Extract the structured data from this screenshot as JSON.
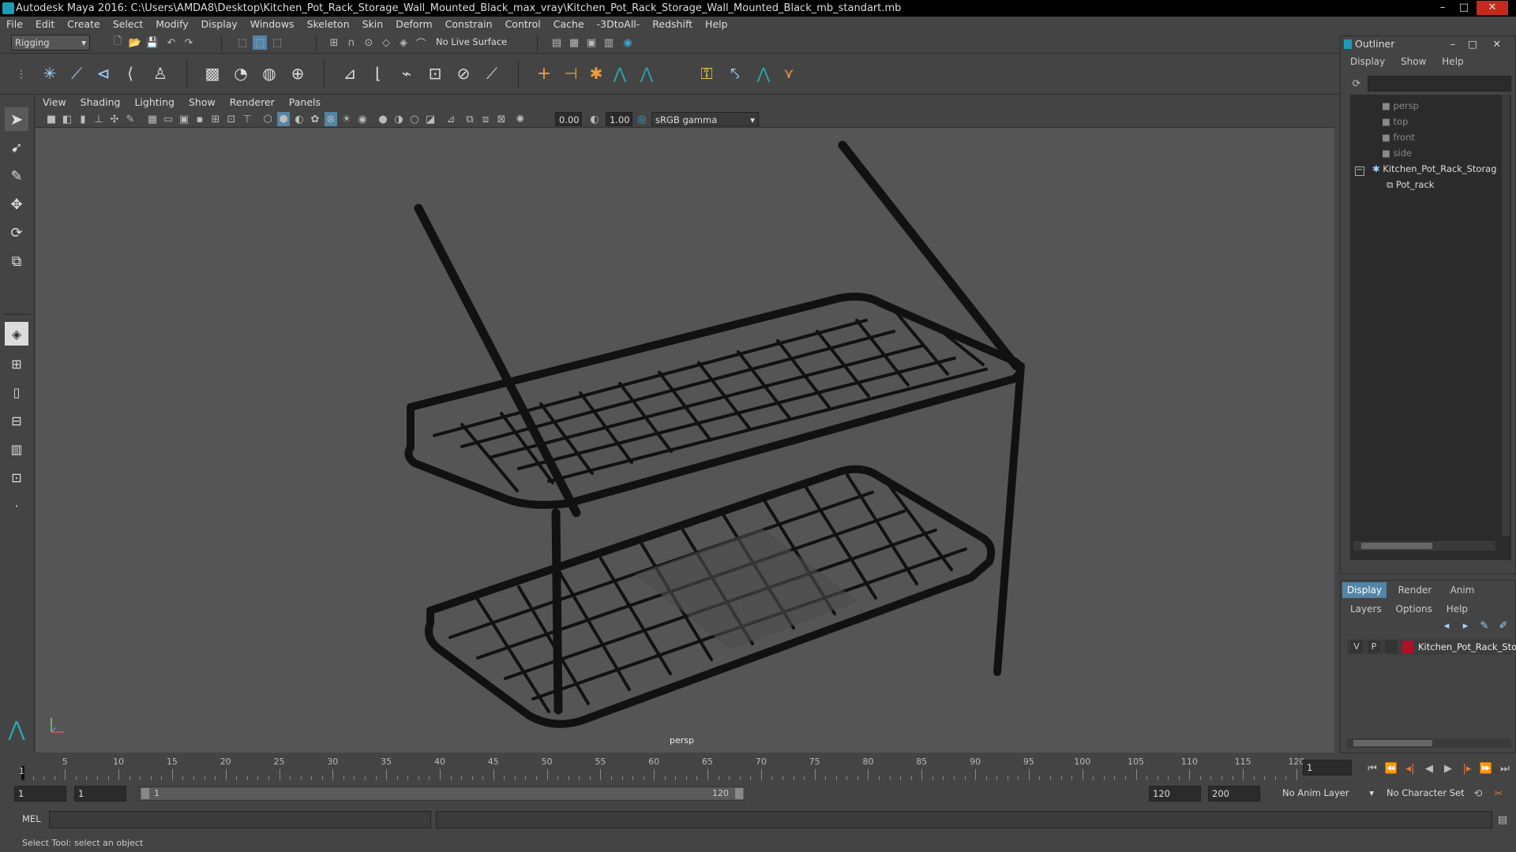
{
  "window": {
    "title": "Autodesk Maya 2016: C:\\Users\\AMDA8\\Desktop\\Kitchen_Pot_Rack_Storage_Wall_Mounted_Black_max_vray\\Kitchen_Pot_Rack_Storage_Wall_Mounted_Black_mb_standart.mb",
    "minimize": "–",
    "maximize": "□",
    "close": "✕"
  },
  "menubar": [
    "File",
    "Edit",
    "Create",
    "Select",
    "Modify",
    "Display",
    "Windows",
    "Skeleton",
    "Skin",
    "Deform",
    "Constrain",
    "Control",
    "Cache",
    "-3DtoAll-",
    "Redshift",
    "Help"
  ],
  "statusline": {
    "menuset": "Rigging",
    "live_surface": "No Live Surface"
  },
  "viewport": {
    "menu": [
      "View",
      "Shading",
      "Lighting",
      "Show",
      "Renderer",
      "Panels"
    ],
    "exposure": "0.00",
    "gamma": "1.00",
    "colorspace": "sRGB gamma",
    "camera_label": "persp"
  },
  "outliner": {
    "title": "Outliner",
    "menu": [
      "Display",
      "Show",
      "Help"
    ],
    "items": [
      {
        "label": "persp",
        "icon": "camera-icon",
        "dim": true
      },
      {
        "label": "top",
        "icon": "camera-icon",
        "dim": true
      },
      {
        "label": "front",
        "icon": "camera-icon",
        "dim": true
      },
      {
        "label": "side",
        "icon": "camera-icon",
        "dim": true
      },
      {
        "label": "Kitchen_Pot_Rack_Storag",
        "icon": "group-icon",
        "dim": false,
        "expand": "−"
      },
      {
        "label": "Pot_rack",
        "icon": "mesh-icon",
        "dim": false
      }
    ]
  },
  "layers": {
    "tabs": [
      "Display",
      "Render",
      "Anim"
    ],
    "menu": [
      "Layers",
      "Options",
      "Help"
    ],
    "layer": {
      "v": "V",
      "p": "P",
      "name": "Kitchen_Pot_Rack_Stor",
      "color": "#b0102a"
    }
  },
  "timeslider": {
    "ticks": [
      "5",
      "10",
      "15",
      "20",
      "25",
      "30",
      "35",
      "40",
      "45",
      "50",
      "55",
      "60",
      "65",
      "70",
      "75",
      "80",
      "85",
      "90",
      "95",
      "100",
      "105",
      "110",
      "115",
      "120"
    ],
    "first_frame": "1",
    "current_frame": "1"
  },
  "range": {
    "start": "1",
    "playback_start": "1",
    "range_start_label": "1",
    "range_end_label": "120",
    "playback_end": "120",
    "end": "200",
    "anim_layer": "No Anim Layer",
    "character_set": "No Character Set"
  },
  "cmd": {
    "label": "MEL"
  },
  "help": {
    "text": "Select Tool: select an object"
  }
}
